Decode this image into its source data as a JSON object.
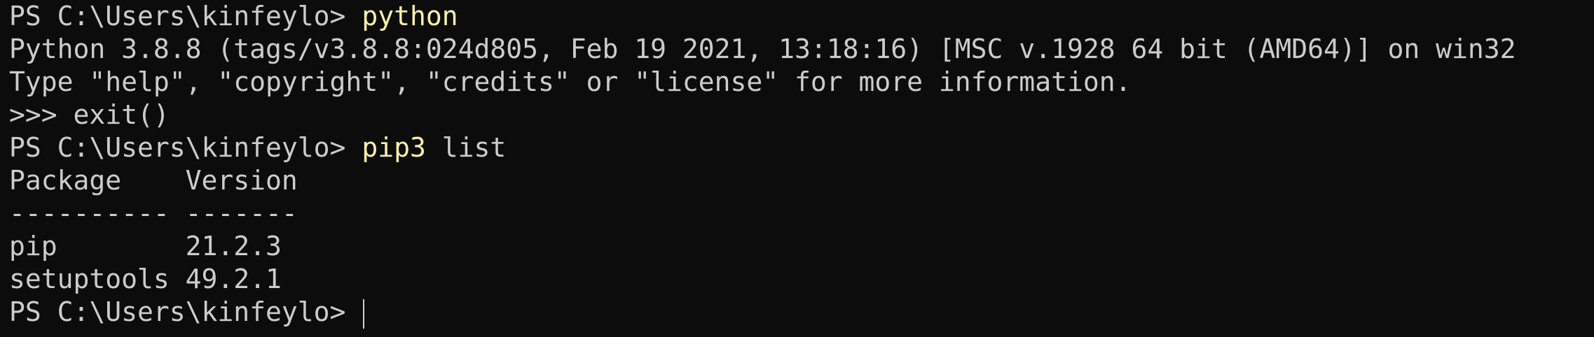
{
  "terminal": {
    "lines": [
      {
        "prompt": "PS C:\\Users\\kinfeylo> ",
        "command": "python"
      },
      {
        "text": "Python 3.8.8 (tags/v3.8.8:024d805, Feb 19 2021, 13:18:16) [MSC v.1928 64 bit (AMD64)] on win32"
      },
      {
        "text": "Type \"help\", \"copyright\", \"credits\" or \"license\" for more information."
      },
      {
        "text": ">>> exit()"
      },
      {
        "prompt": "PS C:\\Users\\kinfeylo> ",
        "command": "pip3",
        "args": " list"
      },
      {
        "text": "Package    Version"
      },
      {
        "text": "---------- -------"
      },
      {
        "text": "pip        21.2.3"
      },
      {
        "text": "setuptools 49.2.1"
      },
      {
        "prompt": "PS C:\\Users\\kinfeylo> "
      }
    ],
    "colors": {
      "background": "#0c0c0c",
      "foreground": "#cccccc",
      "command": "#f9f1a5"
    }
  }
}
